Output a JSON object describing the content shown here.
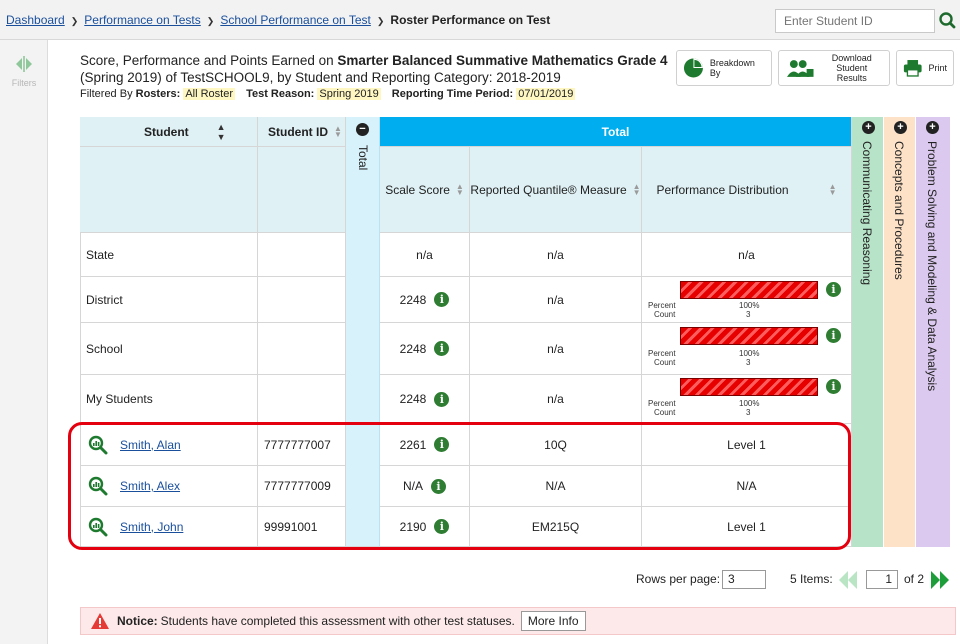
{
  "breadcrumb": {
    "items": [
      "Dashboard",
      "Performance on Tests",
      "School Performance on Test"
    ],
    "current": "Roster Performance on Test"
  },
  "search": {
    "placeholder": "Enter Student ID"
  },
  "sidebar": {
    "filters_label": "Filters"
  },
  "report": {
    "title_prefix": "Score, Performance and Points Earned on ",
    "test_name": "Smarter Balanced Summative Mathematics Grade 4",
    "title_suffix": "(Spring 2019) of TestSCHOOL9, by Student and Reporting Category: 2018-2019",
    "filtered_by": "Filtered By",
    "rosters_key": "Rosters:",
    "rosters_val": "All Roster",
    "reason_key": "Test Reason:",
    "reason_val": "Spring 2019",
    "period_key": "Reporting Time Period:",
    "period_val": "07/01/2019"
  },
  "toolbar": {
    "breakdown": "Breakdown By",
    "download_line1": "Download",
    "download_line2": "Student Results",
    "print": "Print"
  },
  "table": {
    "col_student": "Student",
    "col_student_id": "Student ID",
    "col_total_collapsed": "Total",
    "col_total": "Total",
    "col_scale": "Scale Score",
    "col_quantile": "Reported Quantile® Measure",
    "col_perf": "Performance Distribution",
    "categories": [
      "Communicating Reasoning",
      "Concepts and Procedures",
      "Problem Solving and Modeling & Data Analysis"
    ],
    "summary_rows": [
      {
        "name": "State",
        "scale": "n/a",
        "quantile": "n/a",
        "perf": "n/a"
      },
      {
        "name": "District",
        "scale": "2248",
        "quantile": "n/a",
        "percent": "100%",
        "count": "3"
      },
      {
        "name": "School",
        "scale": "2248",
        "quantile": "n/a",
        "percent": "100%",
        "count": "3"
      },
      {
        "name": "My Students",
        "scale": "2248",
        "quantile": "n/a",
        "percent": "100%",
        "count": "3"
      }
    ],
    "percent_label": "Percent",
    "count_label": "Count",
    "student_rows": [
      {
        "name": "Smith, Alan",
        "id": "7777777007",
        "scale": "2261",
        "quantile": "10Q",
        "level": "Level 1"
      },
      {
        "name": "Smith, Alex",
        "id": "7777777009",
        "scale": "N/A",
        "quantile": "N/A",
        "level": "N/A"
      },
      {
        "name": "Smith, John",
        "id": "99991001",
        "scale": "2190",
        "quantile": "EM215Q",
        "level": "Level 1"
      }
    ],
    "info_glyph": "i"
  },
  "pagination": {
    "rows_label": "Rows per page:",
    "rows_value": "3",
    "items_label": "5 Items:",
    "page_value": "1",
    "of_label": "of 2"
  },
  "notice": {
    "label": "Notice:",
    "text": " Students have completed this assessment with other test statuses.",
    "button": "More Info"
  },
  "colors": {
    "accent": "#00aeef",
    "header_bg": "#dff1f5",
    "cat1": "#b7e3c8",
    "cat2": "#fde2c8",
    "cat3": "#dcc9ef",
    "highlight": "#e4000f"
  }
}
